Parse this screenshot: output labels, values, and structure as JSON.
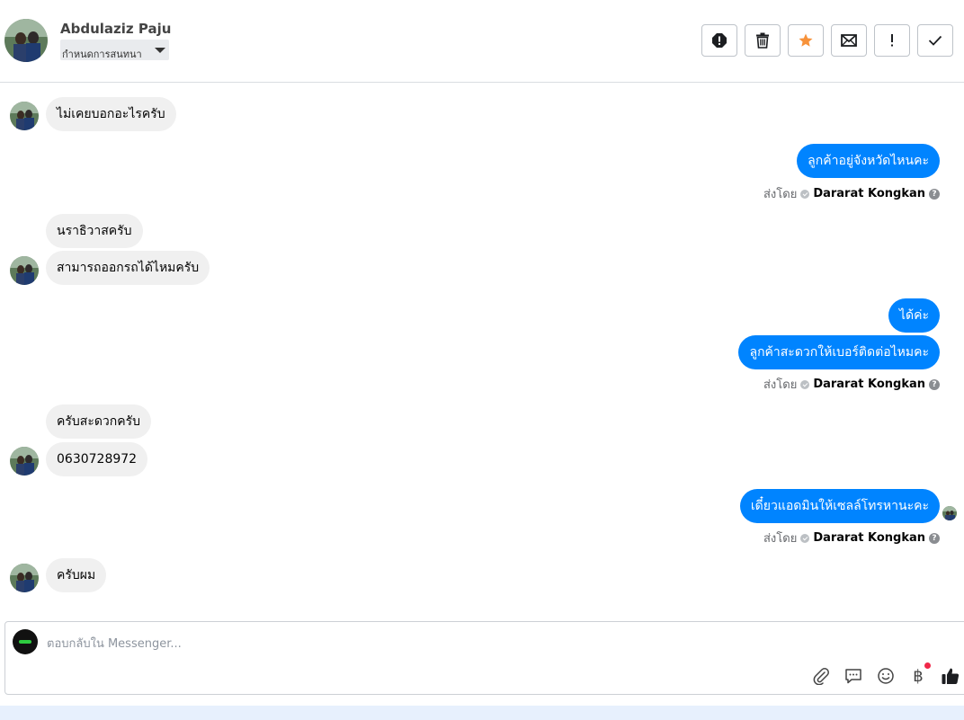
{
  "header": {
    "contact_name": "Abdulaziz Paju",
    "label_select": "กำหนดการสนทนา",
    "toolbar": [
      {
        "name": "report-spam-button",
        "icon": "alert-circle-icon"
      },
      {
        "name": "delete-button",
        "icon": "trash-icon"
      },
      {
        "name": "star-button",
        "icon": "star-icon"
      },
      {
        "name": "mark-unread-button",
        "icon": "envelope-icon"
      },
      {
        "name": "mark-important-button",
        "icon": "exclamation-icon"
      },
      {
        "name": "mark-done-button",
        "icon": "checkmark-icon"
      }
    ]
  },
  "messages": {
    "m1": "ไม่เคยบอกอะไรครับ",
    "m2": "ลูกค้าอยู่จังหวัดไหนคะ",
    "m3": "นราธิวาสครับ",
    "m4": "สามารถออกรถได้ไหมครับ",
    "m5": "ได้ค่ะ",
    "m6": "ลูกค้าสะดวกให้เบอร์ติดต่อไหมคะ",
    "m7": "ครับสะดวกครับ",
    "m8": "0630728972",
    "m9": "เดี๋ยวแอดมินให้เซลล์โทรหานะคะ",
    "m10": "ครับผม"
  },
  "sent_by": {
    "prefix": "ส่งโดย",
    "agent": "Dararat Kongkan",
    "help": "?"
  },
  "composer": {
    "placeholder": "ตอบกลับใน Messenger...",
    "tools": [
      "paperclip-icon",
      "chat-bubble-icon",
      "smiley-icon",
      "baht-icon",
      "thumbs-up-icon"
    ],
    "baht_symbol": "฿"
  },
  "colors": {
    "outgoing_bubble": "#0084ff",
    "incoming_bubble": "#f0f0f0",
    "star": "#f7923a",
    "notification_dot": "#f02849"
  }
}
